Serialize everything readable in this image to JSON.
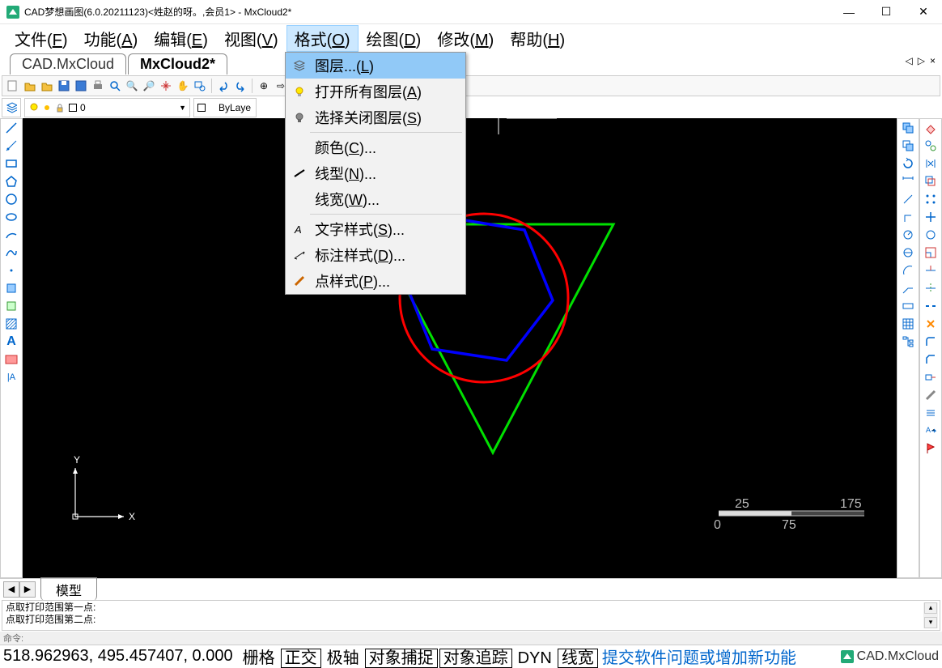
{
  "window": {
    "title": "CAD梦想画图(6.0.20211123)<姓赵的呀。,会员1> - MxCloud2*"
  },
  "menubar": [
    {
      "label": "文件",
      "key": "F"
    },
    {
      "label": "功能",
      "key": "A"
    },
    {
      "label": "编辑",
      "key": "E"
    },
    {
      "label": "视图",
      "key": "V"
    },
    {
      "label": "格式",
      "key": "O",
      "active": true
    },
    {
      "label": "绘图",
      "key": "D"
    },
    {
      "label": "修改",
      "key": "M"
    },
    {
      "label": "帮助",
      "key": "H"
    }
  ],
  "doc_tabs": [
    {
      "label": "CAD.MxCloud",
      "active": false
    },
    {
      "label": "MxCloud2*",
      "active": true
    }
  ],
  "layer": {
    "current": "0",
    "bylayer": "ByLaye"
  },
  "dropdown": [
    {
      "label": "图层...(",
      "key": "L",
      "tail": ")",
      "highlight": true,
      "icon": "layers-icon"
    },
    {
      "label": "打开所有图层(",
      "key": "A",
      "tail": ")",
      "icon": "bulb-icon"
    },
    {
      "label": "选择关闭图层(",
      "key": "S",
      "tail": ")",
      "icon": "bulb-off-icon",
      "sep_after": true
    },
    {
      "label": "颜色(",
      "key": "C",
      "tail": ")..."
    },
    {
      "label": "线型(",
      "key": "N",
      "tail": ")...",
      "icon": "linetype-icon"
    },
    {
      "label": "线宽(",
      "key": "W",
      "tail": ")...",
      "sep_after": true
    },
    {
      "label": "文字样式(",
      "key": "S",
      "tail": ")...",
      "icon": "textstyle-icon"
    },
    {
      "label": "标注样式(",
      "key": "D",
      "tail": ")...",
      "icon": "dimstyle-icon"
    },
    {
      "label": "点样式(",
      "key": "P",
      "tail": ")...",
      "icon": "pointstyle-icon"
    }
  ],
  "scale": {
    "tl": "25",
    "tr": "175",
    "bl": "0",
    "br": "75"
  },
  "axis": {
    "x": "X",
    "y": "Y"
  },
  "model_tab": "模型",
  "cmd": {
    "line1": "点取打印范围第一点:",
    "line2": "点取打印范围第二点:"
  },
  "prompt": "命令:",
  "statusbar": {
    "coords": "518.962963,  495.457407,  0.000",
    "buttons": [
      {
        "label": "栅格",
        "boxed": false
      },
      {
        "label": "正交",
        "boxed": true
      },
      {
        "label": "极轴",
        "boxed": false
      },
      {
        "label": "对象捕捉",
        "boxed": true
      },
      {
        "label": "对象追踪",
        "boxed": true
      },
      {
        "label": "DYN",
        "boxed": false
      },
      {
        "label": "线宽",
        "boxed": true
      }
    ],
    "link": "提交软件问题或增加新功能",
    "brand": "CAD.MxCloud"
  }
}
